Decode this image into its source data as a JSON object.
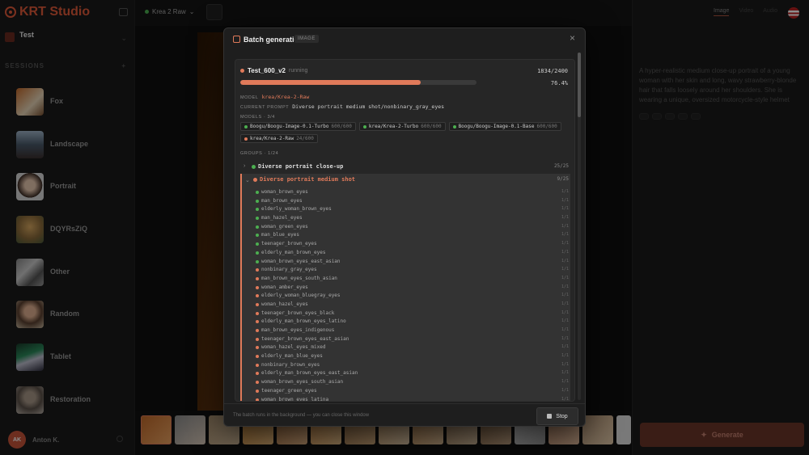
{
  "app": {
    "name": "KRT Studio"
  },
  "sidebar": {
    "workspace": {
      "name": "Test",
      "sub": ""
    },
    "sessions_label": "SESSIONS",
    "sessions": [
      {
        "name": "Fox",
        "date": ""
      },
      {
        "name": "Landscape",
        "date": ""
      },
      {
        "name": "Portrait",
        "date": ""
      },
      {
        "name": "DQYRsZiQ",
        "date": ""
      },
      {
        "name": "Other",
        "date": ""
      },
      {
        "name": "Random",
        "date": ""
      },
      {
        "name": "Tablet",
        "date": ""
      },
      {
        "name": "Restoration",
        "date": ""
      }
    ],
    "user": {
      "initials": "AK",
      "name": "Anton K.",
      "sub": ""
    }
  },
  "topbar": {
    "model": "Krea 2 Raw",
    "status": ""
  },
  "right_panel": {
    "tabs": [
      "Image",
      "Video",
      "Audio"
    ],
    "section": "",
    "section_right": "",
    "prompt_label": "",
    "prompt": "A hyper-realistic medium close-up portrait of a young woman with her skin and long, wavy strawberry-blonde hair that falls loosely around her shoulders. She is wearing a unique, oversized motorcycle-style helmet",
    "chips": [
      "",
      "",
      "",
      "",
      ""
    ],
    "generate_label": "Generate"
  },
  "modal": {
    "title": "Batch generation",
    "badge": "IMAGE",
    "job": {
      "name": "Test_600_v2",
      "state": "running",
      "count": "1834/2400",
      "progress": 0.764,
      "progress_label": "76.4%",
      "model_label": "MODEL",
      "model": "krea/Krea-2-Raw",
      "prompt_label": "CURRENT PROMPT",
      "prompt": "Diverse portrait medium shot/nonbinary_gray_eyes",
      "models_label": "MODELS · 3/4",
      "models": [
        {
          "name": "Boogu/Boogu-Image-0.1-Turbo",
          "count": "600/600",
          "status": "done"
        },
        {
          "name": "krea/Krea-2-Turbo",
          "count": "600/600",
          "status": "done"
        },
        {
          "name": "Boogu/Boogu-Image-0.1-Base",
          "count": "600/600",
          "status": "done"
        },
        {
          "name": "krea/Krea-2-Raw",
          "count": "24/600",
          "status": "running"
        }
      ],
      "groups_label": "GROUPS · 1/24",
      "groups": [
        {
          "name": "Diverse portrait close-up",
          "count": "25/25",
          "status": "done"
        },
        {
          "name": "Diverse portrait medium shot",
          "count": "9/25",
          "status": "running",
          "items": [
            {
              "name": "woman_brown_eyes",
              "count": "1/1",
              "status": "done"
            },
            {
              "name": "man_brown_eyes",
              "count": "1/1",
              "status": "done"
            },
            {
              "name": "elderly_woman_brown_eyes",
              "count": "1/1",
              "status": "done"
            },
            {
              "name": "man_hazel_eyes",
              "count": "1/1",
              "status": "done"
            },
            {
              "name": "woman_green_eyes",
              "count": "1/1",
              "status": "done"
            },
            {
              "name": "man_blue_eyes",
              "count": "1/1",
              "status": "done"
            },
            {
              "name": "teenager_brown_eyes",
              "count": "1/1",
              "status": "done"
            },
            {
              "name": "elderly_man_brown_eyes",
              "count": "1/1",
              "status": "done"
            },
            {
              "name": "woman_brown_eyes_east_asian",
              "count": "1/1",
              "status": "done"
            },
            {
              "name": "nonbinary_gray_eyes",
              "count": "1/1",
              "status": "running"
            },
            {
              "name": "man_brown_eyes_south_asian",
              "count": "1/1",
              "status": "pending"
            },
            {
              "name": "woman_amber_eyes",
              "count": "1/1",
              "status": "pending"
            },
            {
              "name": "elderly_woman_bluegray_eyes",
              "count": "1/1",
              "status": "pending"
            },
            {
              "name": "woman_hazel_eyes",
              "count": "1/1",
              "status": "pending"
            },
            {
              "name": "teenager_brown_eyes_black",
              "count": "1/1",
              "status": "pending"
            },
            {
              "name": "elderly_man_brown_eyes_latino",
              "count": "1/1",
              "status": "pending"
            },
            {
              "name": "man_brown_eyes_indigenous",
              "count": "1/1",
              "status": "pending"
            },
            {
              "name": "teenager_brown_eyes_east_asian",
              "count": "1/1",
              "status": "pending"
            },
            {
              "name": "woman_hazel_eyes_mixed",
              "count": "1/1",
              "status": "pending"
            },
            {
              "name": "elderly_man_blue_eyes",
              "count": "1/1",
              "status": "pending"
            },
            {
              "name": "nonbinary_brown_eyes",
              "count": "1/1",
              "status": "pending"
            },
            {
              "name": "elderly_man_brown_eyes_east_asian",
              "count": "1/1",
              "status": "pending"
            },
            {
              "name": "woman_brown_eyes_south_asian",
              "count": "1/1",
              "status": "pending"
            },
            {
              "name": "teenager_green_eyes",
              "count": "1/1",
              "status": "pending"
            },
            {
              "name": "woman_brown_eyes_latina",
              "count": "1/1",
              "status": "pending"
            }
          ]
        }
      ]
    },
    "footer_note": "The batch runs in the background — you can close this window",
    "stop_label": "Stop"
  },
  "colors": {
    "accent": "#e07a5a",
    "done": "#4caf50",
    "running": "#e07a5a",
    "pending": "#e07a5a"
  }
}
